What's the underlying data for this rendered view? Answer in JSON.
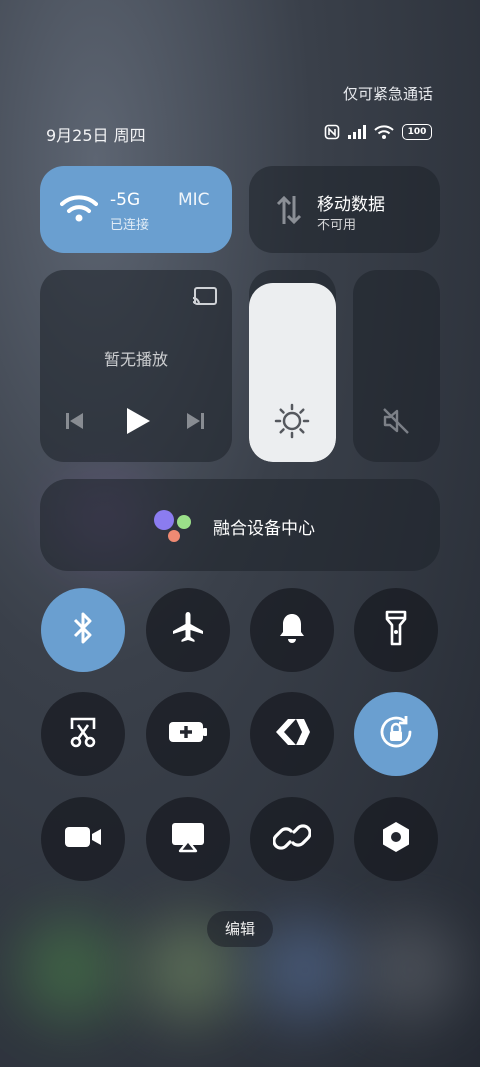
{
  "status": {
    "emergency_text": "仅可紧急通话",
    "date_text": "9月25日 周四",
    "battery_level": "100"
  },
  "wifi": {
    "title": "-5G",
    "title_trail": "MIC",
    "subtitle": "已连接"
  },
  "mobile_data": {
    "title": "移动数据",
    "subtitle": "不可用"
  },
  "media": {
    "placeholder": "暂无播放"
  },
  "brightness": {
    "level": 0.93
  },
  "device_hub": {
    "label": "融合设备中心"
  },
  "toggles": [
    {
      "name": "bluetooth",
      "on": true
    },
    {
      "name": "airplane-mode",
      "on": false
    },
    {
      "name": "ringer",
      "on": false
    },
    {
      "name": "flashlight",
      "on": false
    },
    {
      "name": "screenshot",
      "on": false
    },
    {
      "name": "battery-saver",
      "on": false
    },
    {
      "name": "quick-share",
      "on": false
    },
    {
      "name": "rotation-lock",
      "on": true
    },
    {
      "name": "screen-record",
      "on": false
    },
    {
      "name": "screen-cast",
      "on": false
    },
    {
      "name": "device-link",
      "on": false
    },
    {
      "name": "settings",
      "on": false
    }
  ],
  "edit_label": "编辑",
  "colors": {
    "accent": "#6a9fd0",
    "tile_bg": "#23262e"
  }
}
